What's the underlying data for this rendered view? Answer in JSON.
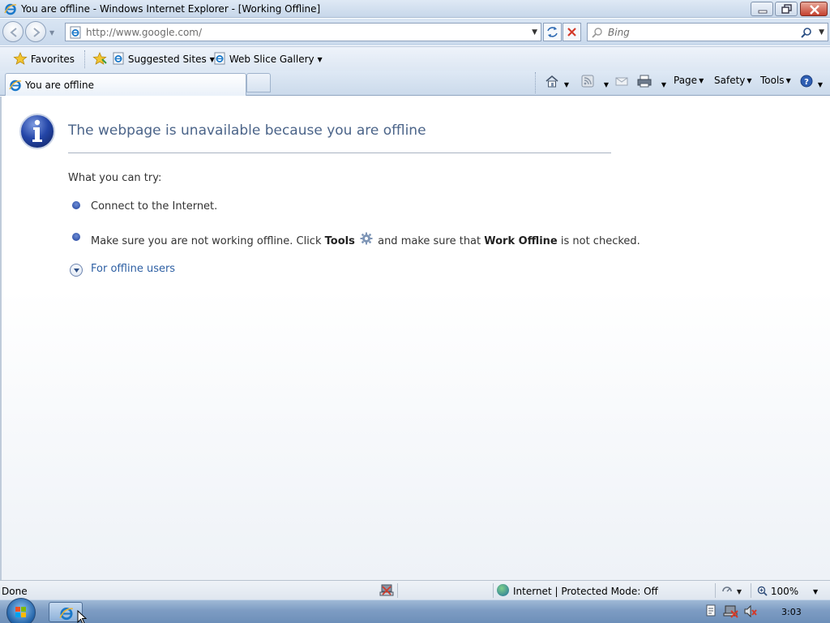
{
  "window": {
    "title": "You are offline - Windows Internet Explorer - [Working Offline]"
  },
  "address_bar": {
    "url": "http://www.google.com/",
    "search_placeholder": "Bing"
  },
  "favorites_bar": {
    "favorites_label": "Favorites",
    "items": [
      {
        "label": "Suggested Sites",
        "icon": "ie-page-icon"
      },
      {
        "label": "Web Slice Gallery",
        "icon": "ie-page-icon"
      }
    ]
  },
  "tabs": [
    {
      "label": "You are offline",
      "active": true
    }
  ],
  "command_bar": {
    "page": "Page",
    "safety": "Safety",
    "tools": "Tools"
  },
  "content": {
    "heading": "The webpage is unavailable because you are offline",
    "try_label": "What you can try:",
    "item1": "Connect to the Internet.",
    "item2_pre": "Make sure you are not working offline. Click ",
    "item2_tools": "Tools",
    "item2_mid": " and make sure that ",
    "item2_work_offline": "Work Offline",
    "item2_post": " is not checked.",
    "expand_link": "For offline users"
  },
  "status_bar": {
    "status": "Done",
    "zone": "Internet | Protected Mode: Off",
    "zoom": "100%"
  },
  "taskbar": {
    "clock": "3:03"
  },
  "colors": {
    "heading": "#4b6489",
    "link": "#2d5fa3",
    "bullet": "#1e3f9a"
  }
}
